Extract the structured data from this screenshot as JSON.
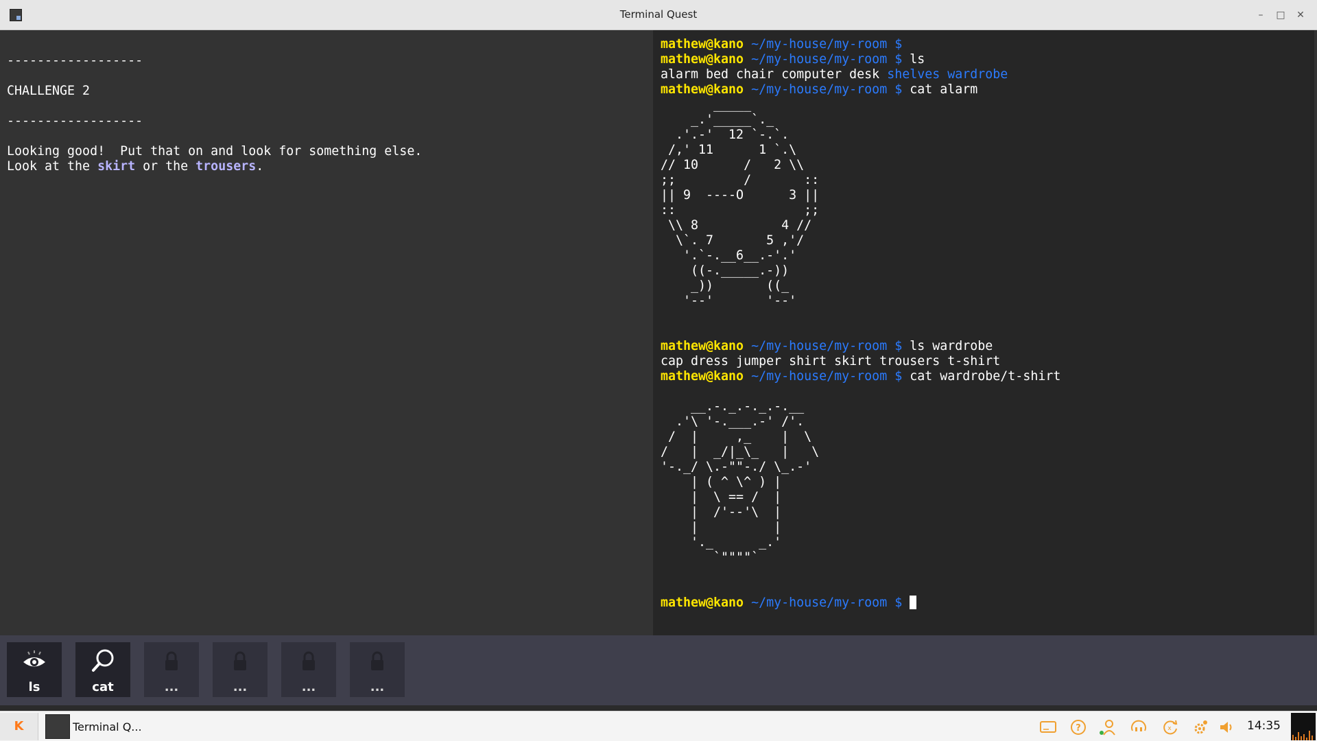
{
  "window": {
    "title": "Terminal Quest",
    "minimize": "–",
    "maximize": "□",
    "close": "✕"
  },
  "story": {
    "line1": "------------------",
    "line2": "CHALLENGE 2",
    "line3": "------------------",
    "line4": "Looking good!  Put that on and look for something else.",
    "line5_pre": "Look at the ",
    "line5_hl1": "skirt",
    "line5_mid": " or the ",
    "line5_hl2": "trousers",
    "line5_post": "."
  },
  "terminal": {
    "user": "mathew@kano",
    "path": " ~/my-house/my-room $",
    "cmd1": "",
    "cmd2": " ls",
    "ls_files": "alarm bed chair computer desk ",
    "ls_dir1": "shelves",
    "ls_sep": " ",
    "ls_dir2": "wardrobe",
    "cmd3": " cat alarm",
    "alarm_art": "       _____\n    _.'_____`._\n  .'.-'  12 `-.`.\n /,' 11      1 `.\\\n// 10      /   2 \\\\\n;;         /       ::\n|| 9  ----O      3 ||\n::                 ;;\n \\\\ 8           4 //\n  \\`. 7       5 ,'/\n   '.`-.__6__.-'.'\n    ((-._____.-))\n    _))       ((_\n   '--'       '--'",
    "cmd4": " ls wardrobe",
    "wardrobe_files": "cap dress jumper shirt skirt trousers t-shirt",
    "cmd5": " cat wardrobe/t-shirt",
    "tshirt_art": "    __.-._.-._.-.__\n  .'\\ '-.___.-' /'.\n /  |     ,_    |  \\\n/   |  _/|_\\_   |   \\\n'-._/ \\.-\"\"-./ \\_.-'\n    | ( ^ \\^ ) |\n    |  \\ == /  |\n    |  /'--'\\  |\n    |          |\n    '._      _.'\n       `\"\"\"\"`",
    "cmd6": " "
  },
  "tools": [
    {
      "label": "ls",
      "icon": "eye-icon"
    },
    {
      "label": "cat",
      "icon": "magnifier-icon"
    },
    {
      "label": "...",
      "icon": "lock-icon"
    },
    {
      "label": "...",
      "icon": "lock-icon"
    },
    {
      "label": "...",
      "icon": "lock-icon"
    },
    {
      "label": "...",
      "icon": "lock-icon"
    }
  ],
  "taskbar": {
    "start_label": "K",
    "task_label": "Terminal Q...",
    "clock": "14:35",
    "tray_icons": [
      "monitor-icon",
      "help-icon",
      "user-icon",
      "sound-icon",
      "update-icon",
      "settings-icon",
      "volume-icon"
    ]
  },
  "colors": {
    "prompt_user": "#ffe600",
    "prompt_path": "#2b7bff",
    "highlight": "#b8b4ff",
    "accent": "#ff7a1a"
  }
}
